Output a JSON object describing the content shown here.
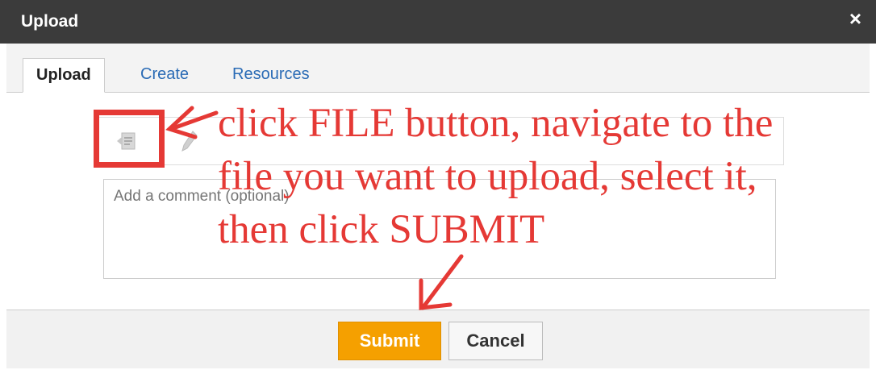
{
  "dialog": {
    "title": "Upload",
    "close_label": "×"
  },
  "tabs": [
    {
      "label": "Upload",
      "active": true
    },
    {
      "label": "Create",
      "active": false
    },
    {
      "label": "Resources",
      "active": false
    }
  ],
  "toolbar": {
    "file_icon": "file-icon",
    "edit_icon": "pencil-icon"
  },
  "comment": {
    "placeholder": "Add a comment (optional)",
    "value": ""
  },
  "annotation": {
    "lines": [
      "click FILE button, navigate to the",
      "file you want to upload, select it,",
      "then click SUBMIT"
    ],
    "color": "#e53935"
  },
  "buttons": {
    "submit_label": "Submit",
    "cancel_label": "Cancel"
  },
  "colors": {
    "titlebar": "#3b3b3b",
    "submit": "#f5a000",
    "link": "#2a6bb5"
  }
}
